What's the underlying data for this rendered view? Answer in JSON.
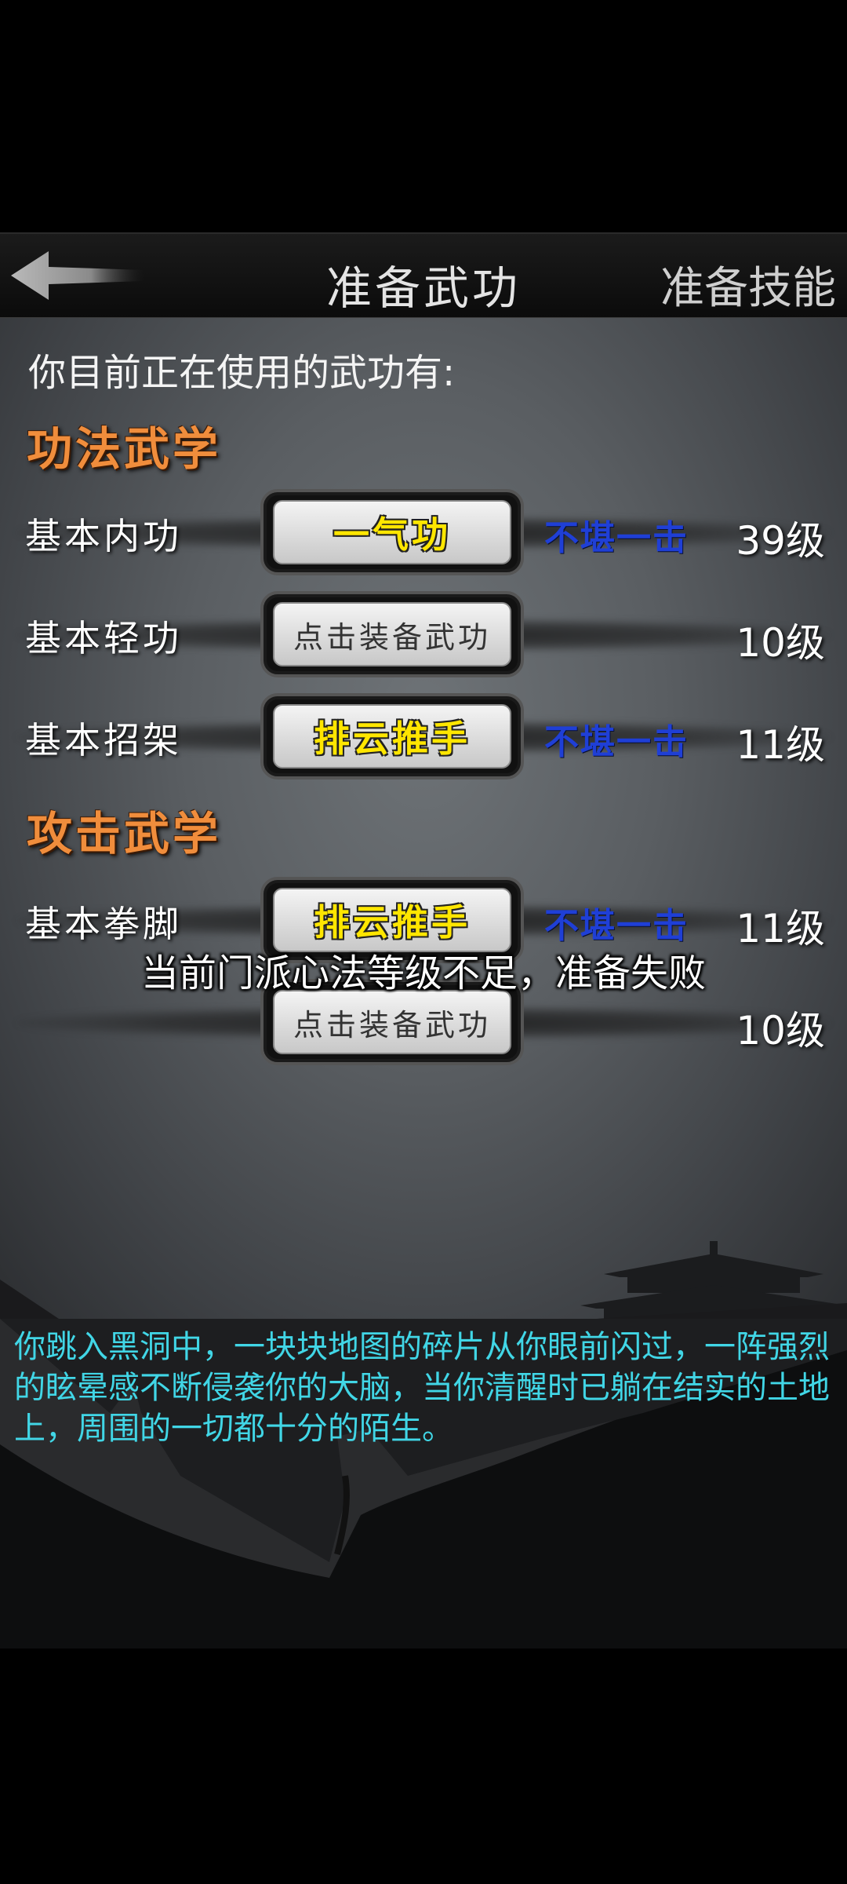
{
  "header": {
    "title": "准备武功",
    "skill_tab": "准备技能"
  },
  "intro": "你目前正在使用的武功有:",
  "sections": {
    "internal": "功法武学",
    "attack": "攻击武学"
  },
  "rows": [
    {
      "label": "基本内功",
      "slot": "一气功",
      "slot_filled": true,
      "rank": "不堪一击",
      "level": "39级"
    },
    {
      "label": "基本轻功",
      "slot": "点击装备武功",
      "slot_filled": false,
      "rank": "",
      "level": "10级"
    },
    {
      "label": "基本招架",
      "slot": "排云推手",
      "slot_filled": true,
      "rank": "不堪一击",
      "level": "11级"
    },
    {
      "label": "基本拳脚",
      "slot": "排云推手",
      "slot_filled": true,
      "rank": "不堪一击",
      "level": "11级"
    },
    {
      "label": "",
      "slot": "点击装备武功",
      "slot_filled": false,
      "rank": "",
      "level": "10级"
    }
  ],
  "toast": "当前门派心法等级不足，准备失败",
  "story": "你跳入黑洞中，一块块地图的碎片从你眼前闪过，一阵强烈的眩晕感不断侵袭你的大脑，当你清醒时已躺在结实的土地上，周围的一切都十分的陌生。",
  "colors": {
    "section_title": "#f08d3c",
    "skill_name": "#ffe600",
    "rank_text": "#1f3fd6",
    "story_text": "#41d6e6"
  },
  "icons": {
    "back": "back-arrow-icon"
  }
}
